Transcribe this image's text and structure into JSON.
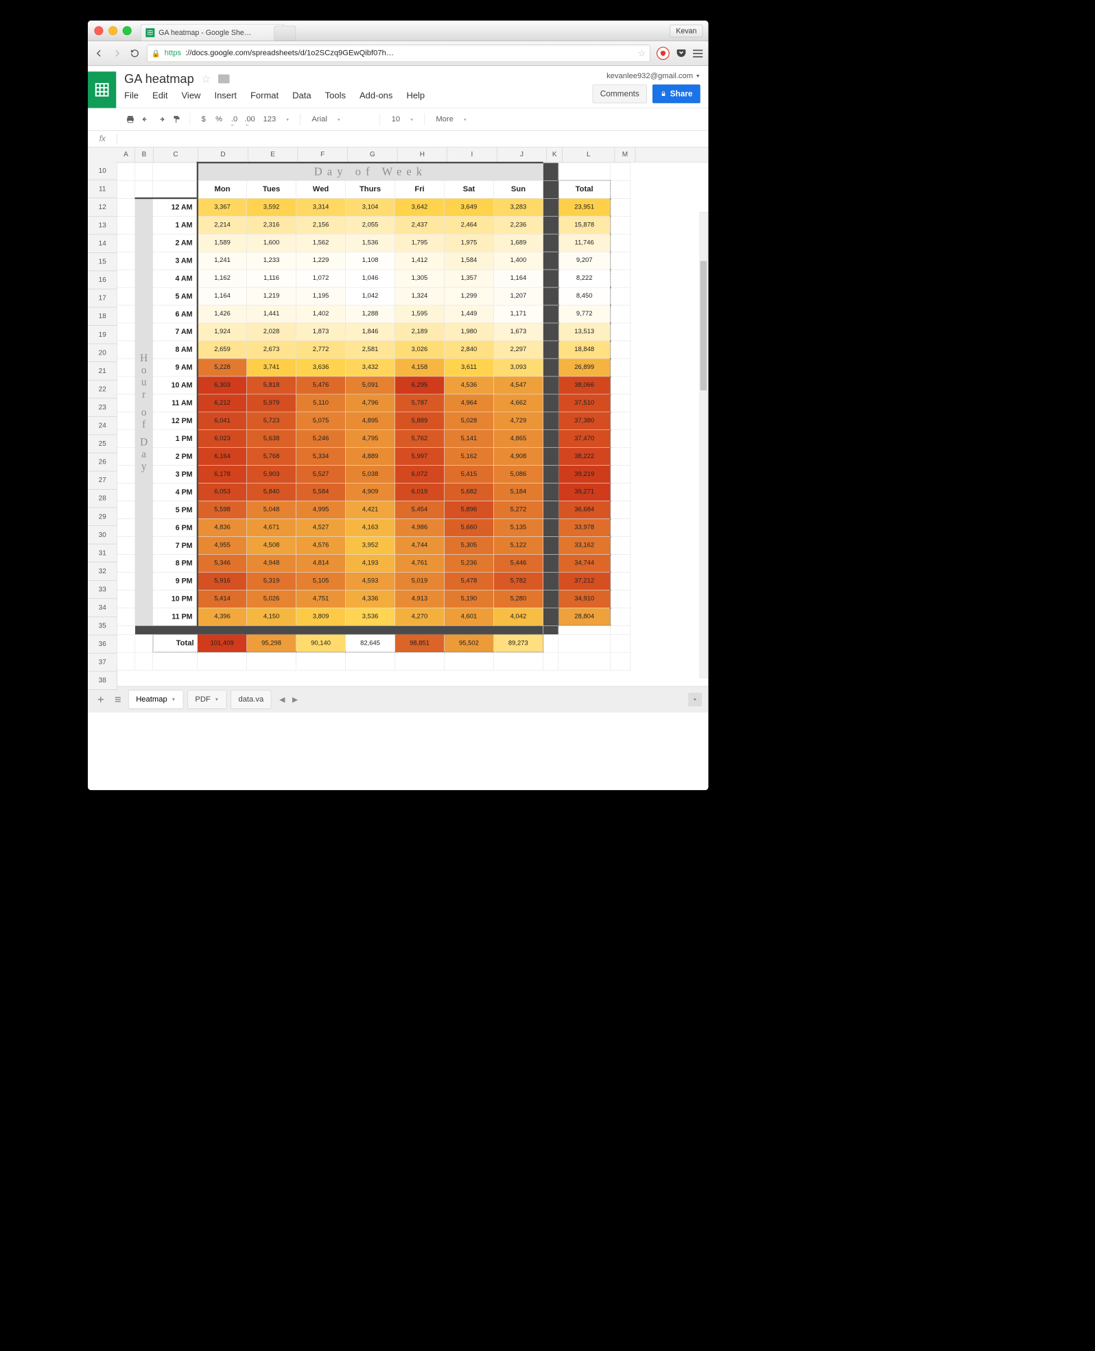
{
  "browser": {
    "tab_title": "GA heatmap - Google She…",
    "profile": "Kevan",
    "url_secure": "https",
    "url_rest": "://docs.google.com/spreadsheets/d/1o2SCzq9GEwQibf07h…"
  },
  "docs": {
    "title": "GA heatmap",
    "account": "kevanlee932@gmail.com",
    "menus": [
      "File",
      "Edit",
      "View",
      "Insert",
      "Format",
      "Data",
      "Tools",
      "Add-ons",
      "Help"
    ],
    "comments_btn": "Comments",
    "share_btn": "Share"
  },
  "toolbar": {
    "currency": "$",
    "percent": "%",
    "dec_dec": ".0",
    "dec_inc": ".00",
    "num_fmt": "123",
    "font": "Arial",
    "size": "10",
    "more": "More"
  },
  "formula_bar": {
    "fx": "fx"
  },
  "grid": {
    "col_letters": [
      "A",
      "B",
      "C",
      "D",
      "E",
      "F",
      "G",
      "H",
      "I",
      "J",
      "K",
      "L",
      "M"
    ],
    "row_numbers": [
      "10",
      "11",
      "12",
      "13",
      "14",
      "15",
      "16",
      "17",
      "18",
      "19",
      "20",
      "21",
      "22",
      "23",
      "24",
      "25",
      "26",
      "27",
      "28",
      "29",
      "30",
      "31",
      "32",
      "33",
      "34",
      "35",
      "36",
      "37",
      "38"
    ],
    "dow_title": "Day of Week",
    "hod_title": "Hour of Day"
  },
  "chart_data": {
    "type": "heatmap",
    "title": "GA heatmap — Day of Week × Hour of Day",
    "xlabel": "Day of Week",
    "ylabel": "Hour of Day",
    "days": [
      "Mon",
      "Tues",
      "Wed",
      "Thurs",
      "Fri",
      "Sat",
      "Sun"
    ],
    "hours": [
      "12 AM",
      "1 AM",
      "2 AM",
      "3 AM",
      "4 AM",
      "5 AM",
      "6 AM",
      "7 AM",
      "8 AM",
      "9 AM",
      "10 AM",
      "11 AM",
      "12 PM",
      "1 PM",
      "2 PM",
      "3 PM",
      "4 PM",
      "5 PM",
      "6 PM",
      "7 PM",
      "8 PM",
      "9 PM",
      "10 PM",
      "11 PM"
    ],
    "values": [
      [
        3367,
        3592,
        3314,
        3104,
        3642,
        3649,
        3283
      ],
      [
        2214,
        2316,
        2156,
        2055,
        2437,
        2464,
        2236
      ],
      [
        1589,
        1600,
        1562,
        1536,
        1795,
        1975,
        1689
      ],
      [
        1241,
        1233,
        1229,
        1108,
        1412,
        1584,
        1400
      ],
      [
        1162,
        1116,
        1072,
        1046,
        1305,
        1357,
        1164
      ],
      [
        1164,
        1219,
        1195,
        1042,
        1324,
        1299,
        1207
      ],
      [
        1426,
        1441,
        1402,
        1288,
        1595,
        1449,
        1171
      ],
      [
        1924,
        2028,
        1873,
        1846,
        2189,
        1980,
        1673
      ],
      [
        2659,
        2673,
        2772,
        2581,
        3026,
        2840,
        2297
      ],
      [
        5228,
        3741,
        3636,
        3432,
        4158,
        3611,
        3093
      ],
      [
        6303,
        5818,
        5476,
        5091,
        6295,
        4536,
        4547
      ],
      [
        6212,
        5979,
        5110,
        4796,
        5787,
        4964,
        4662
      ],
      [
        6041,
        5723,
        5075,
        4895,
        5889,
        5028,
        4729
      ],
      [
        6023,
        5638,
        5246,
        4795,
        5762,
        5141,
        4865
      ],
      [
        6164,
        5768,
        5334,
        4889,
        5997,
        5162,
        4908
      ],
      [
        6178,
        5903,
        5527,
        5038,
        6072,
        5415,
        5086
      ],
      [
        6053,
        5840,
        5584,
        4909,
        6019,
        5682,
        5184
      ],
      [
        5598,
        5048,
        4995,
        4421,
        5454,
        5896,
        5272
      ],
      [
        4836,
        4671,
        4527,
        4163,
        4986,
        5660,
        5135
      ],
      [
        4955,
        4508,
        4576,
        3952,
        4744,
        5305,
        5122
      ],
      [
        5346,
        4948,
        4814,
        4193,
        4761,
        5236,
        5446
      ],
      [
        5916,
        5319,
        5105,
        4593,
        5019,
        5478,
        5782
      ],
      [
        5414,
        5026,
        4751,
        4336,
        4913,
        5190,
        5280
      ],
      [
        4396,
        4150,
        3809,
        3536,
        4270,
        4601,
        4042
      ]
    ],
    "row_totals_label": "Total",
    "row_totals": [
      23951,
      15878,
      11746,
      9207,
      8222,
      8450,
      9772,
      13513,
      18848,
      26899,
      38066,
      37510,
      37380,
      37470,
      38222,
      39219,
      39271,
      36684,
      33978,
      33162,
      34744,
      37212,
      34910,
      28804
    ],
    "col_totals_label": "Total",
    "col_totals": [
      101409,
      95298,
      90140,
      82645,
      98851,
      95502,
      89273
    ],
    "color_scale": {
      "low": "#ffffff",
      "mid": "#ffd24a",
      "high": "#cf3b1b"
    }
  },
  "sheet_tabs": {
    "active": "Heatmap",
    "others": [
      "PDF",
      "data.va"
    ]
  }
}
